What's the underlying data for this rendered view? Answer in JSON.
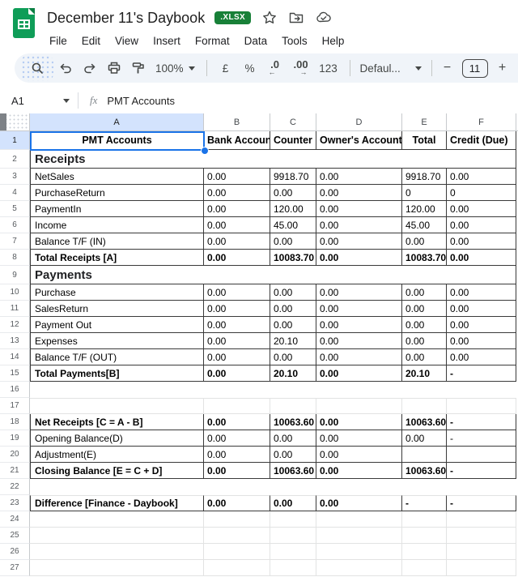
{
  "app": {
    "doc_title": "December 11's Daybook",
    "file_badge": ".XLSX",
    "menu": [
      "File",
      "Edit",
      "View",
      "Insert",
      "Format",
      "Data",
      "Tools",
      "Help"
    ],
    "colors": {
      "accent_blue": "#1a73e8",
      "logo_green": "#0f9d58",
      "badge_green": "#188038",
      "alert_red": "#ea4335",
      "selected_header_bg": "#d3e3fd"
    },
    "icons": {
      "sheets-logo-icon": "green sheet with white table grid",
      "star-icon": "star outline",
      "move-folder-icon": "folder with arrow",
      "cloud-check-icon": "cloud with checkmark",
      "search-icon": "magnifier",
      "undo-icon": "curved arrow left",
      "redo-icon": "curved arrow right",
      "print-icon": "printer",
      "paint-format-icon": "paint roller",
      "fx-icon": "fx"
    }
  },
  "toolbar": {
    "zoom_level": "100%",
    "currency": "£",
    "percent": "%",
    "decimal_decrease": ".0",
    "decimal_decrease_arrow": "←",
    "decimal_increase": ".00",
    "decimal_increase_arrow": "→",
    "number_format": "123",
    "font_name": "Defaul...",
    "minus": "−",
    "font_size": "11",
    "plus": "+"
  },
  "formula_bar": {
    "cell_ref": "A1",
    "fx_label": "fx",
    "value": "PMT Accounts"
  },
  "grid": {
    "columns": [
      "A",
      "B",
      "C",
      "D",
      "E",
      "F"
    ],
    "selected": {
      "cell": "A1",
      "column": "A",
      "row": 1
    },
    "rows": [
      {
        "n": 1,
        "type": "header",
        "bold": true,
        "a": "PMT Accounts",
        "b": "Bank Account",
        "c": "Counter",
        "d": "Owner's Account",
        "e": "Total",
        "f": "Credit (Due)"
      },
      {
        "n": 2,
        "type": "section",
        "a": "Receipts"
      },
      {
        "n": 3,
        "type": "data",
        "a": "NetSales",
        "b": "0.00",
        "c": "9918.70",
        "d": "0.00",
        "e": "9918.70",
        "f": "0.00"
      },
      {
        "n": 4,
        "type": "data",
        "a": "PurchaseReturn",
        "b": "0.00",
        "c": "0.00",
        "d": "0.00",
        "e": "0",
        "f": "0"
      },
      {
        "n": 5,
        "type": "data",
        "a": "PaymentIn",
        "b": "0.00",
        "c": "120.00",
        "d": "0.00",
        "e": "120.00",
        "f": "0.00"
      },
      {
        "n": 6,
        "type": "data",
        "a": "Income",
        "b": "0.00",
        "c": "45.00",
        "d": "0.00",
        "e": "45.00",
        "f": "0.00"
      },
      {
        "n": 7,
        "type": "data",
        "a": "Balance T/F (IN)",
        "b": "0.00",
        "c": "0.00",
        "d": "0.00",
        "e": "0.00",
        "f": "0.00"
      },
      {
        "n": 8,
        "type": "data",
        "bold": true,
        "a": "Total Receipts [A]",
        "b": "0.00",
        "c": "10083.70",
        "d": "0.00",
        "e": "10083.70",
        "f": "0.00"
      },
      {
        "n": 9,
        "type": "section",
        "a": "Payments"
      },
      {
        "n": 10,
        "type": "data",
        "a": "Purchase",
        "b": "0.00",
        "c": "0.00",
        "d": "0.00",
        "e": "0.00",
        "f": "0.00"
      },
      {
        "n": 11,
        "type": "data",
        "a": "SalesReturn",
        "b": "0.00",
        "c": "0.00",
        "d": "0.00",
        "e": "0.00",
        "f": "0.00"
      },
      {
        "n": 12,
        "type": "data",
        "a": "Payment Out",
        "b": "0.00",
        "c": "0.00",
        "d": "0.00",
        "e": "0.00",
        "f": "0.00"
      },
      {
        "n": 13,
        "type": "data",
        "a": "Expenses",
        "b": "0.00",
        "c": "20.10",
        "d": "0.00",
        "e": "0.00",
        "f": "0.00"
      },
      {
        "n": 14,
        "type": "data",
        "a": "Balance T/F (OUT)",
        "b": "0.00",
        "c": "0.00",
        "d": "0.00",
        "e": "0.00",
        "f": "0.00"
      },
      {
        "n": 15,
        "type": "data",
        "bold": true,
        "a": "Total Payments[B]",
        "b": "0.00",
        "c": "20.10",
        "d": "0.00",
        "e": "20.10",
        "f": "-"
      },
      {
        "n": 16,
        "type": "blank"
      },
      {
        "n": 17,
        "type": "grid",
        "topline": true
      },
      {
        "n": 18,
        "type": "data",
        "bold": true,
        "a": "Net Receipts [C = A - B]",
        "b": "0.00",
        "c": "10063.60",
        "d": "0.00",
        "e": "10063.60",
        "f": "-"
      },
      {
        "n": 19,
        "type": "data",
        "a": "Opening Balance(D)",
        "b": "0.00",
        "c": "0.00",
        "d": "0.00",
        "e": "0.00",
        "f": "-"
      },
      {
        "n": 20,
        "type": "data",
        "a": "Adjustment(E)",
        "b": "0.00",
        "c": "0.00",
        "d": "0.00",
        "e": "",
        "f": ""
      },
      {
        "n": 21,
        "type": "data",
        "bold": true,
        "a": "Closing Balance [E = C + D]",
        "b": "0.00",
        "c": "10063.60",
        "d": "0.00",
        "e": "10063.60",
        "f": "-"
      },
      {
        "n": 22,
        "type": "blank"
      },
      {
        "n": 23,
        "type": "data",
        "bold": true,
        "topline": true,
        "a": "Difference [Finance - Daybook]",
        "b": "0.00",
        "c": "0.00",
        "d": "0.00",
        "e": "-",
        "f": "-"
      },
      {
        "n": 24,
        "type": "grid"
      },
      {
        "n": 25,
        "type": "grid"
      },
      {
        "n": 26,
        "type": "grid"
      },
      {
        "n": 27,
        "type": "grid"
      }
    ]
  }
}
